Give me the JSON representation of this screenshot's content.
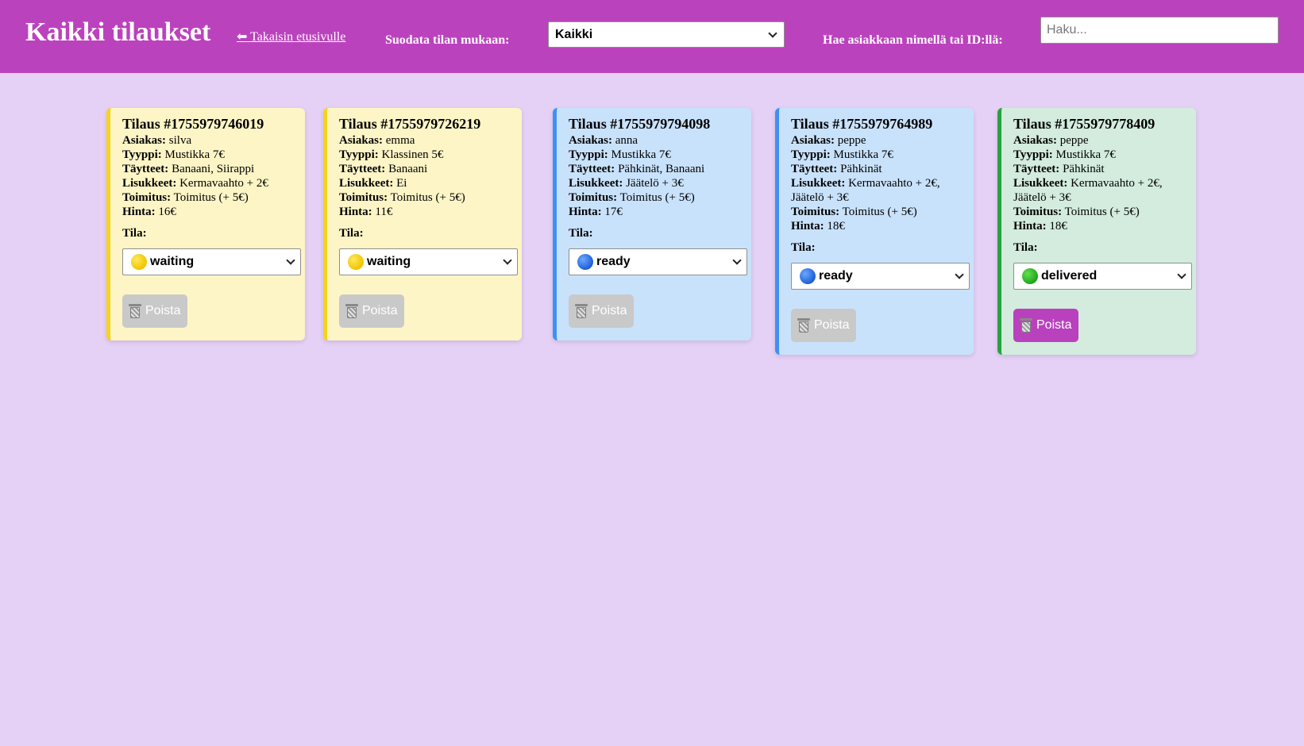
{
  "header": {
    "title": "Kaikki tilaukset",
    "back_link": "⬅ Takaisin etusivulle",
    "filter_label": "Suodata tilan mukaan:",
    "filter_value": "Kaikki",
    "search_label": "Hae asiakkaan nimellä tai ID:llä:",
    "search_placeholder": "Haku..."
  },
  "labels": {
    "customer": "Asiakas:",
    "type": "Tyyppi:",
    "fillings": "Täytteet:",
    "extras": "Lisukkeet:",
    "delivery": "Toimitus:",
    "price": "Hinta:",
    "status": "Tila:",
    "delete": "Poista"
  },
  "colors": {
    "header_bg": "#bb42bd",
    "page_bg": "#e5d0f6",
    "waiting": "#fdf5c6",
    "ready": "#c9e2fb",
    "delivered": "#d3ecdd"
  },
  "orders": [
    {
      "title": "Tilaus #1755979746019",
      "customer": "silva",
      "type": "Mustikka 7€",
      "fillings": "Banaani, Siirappi",
      "extras": "Kermavaahto + 2€",
      "delivery": "Toimitus (+ 5€)",
      "price": "16€",
      "status": "waiting",
      "status_icon": "yellow-circle-icon"
    },
    {
      "title": "Tilaus #1755979726219",
      "customer": "emma",
      "type": "Klassinen 5€",
      "fillings": "Banaani",
      "extras": "Ei",
      "delivery": "Toimitus (+ 5€)",
      "price": "11€",
      "status": "waiting",
      "status_icon": "yellow-circle-icon"
    },
    {
      "title": "Tilaus #1755979794098",
      "customer": "anna",
      "type": "Mustikka 7€",
      "fillings": "Pähkinät, Banaani",
      "extras": "Jäätelö + 3€",
      "delivery": "Toimitus (+ 5€)",
      "price": "17€",
      "status": "ready",
      "status_icon": "blue-circle-icon"
    },
    {
      "title": "Tilaus #1755979764989",
      "customer": "peppe",
      "type": "Mustikka 7€",
      "fillings": "Pähkinät",
      "extras": "Kermavaahto + 2€, Jäätelö + 3€",
      "delivery": "Toimitus (+ 5€)",
      "price": "18€",
      "status": "ready",
      "status_icon": "blue-circle-icon"
    },
    {
      "title": "Tilaus #1755979778409",
      "customer": "peppe",
      "type": "Mustikka 7€",
      "fillings": "Pähkinät",
      "extras": "Kermavaahto + 2€, Jäätelö + 3€",
      "delivery": "Toimitus (+ 5€)",
      "price": "18€",
      "status": "delivered",
      "status_icon": "green-circle-icon"
    }
  ]
}
